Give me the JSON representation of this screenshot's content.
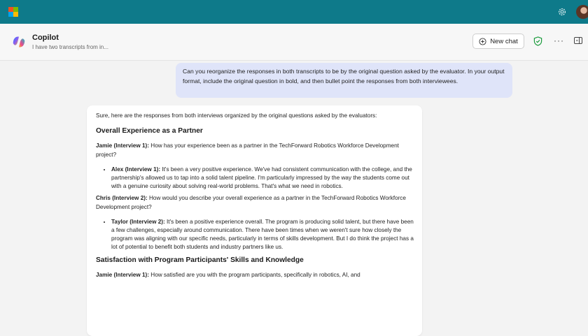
{
  "app": {
    "name": "Copilot",
    "subtitle": "I have two transcripts from in...",
    "topbar_color": "#0e7a8a"
  },
  "header": {
    "new_chat_label": "New chat",
    "more_label": "···"
  },
  "user_message": "Can you reorganize the responses in both transcripts to be by the original question asked by the evaluator. In your output format, include the original question in bold, and then bullet point the responses from both interviewees.",
  "response": {
    "intro": "Sure, here are the responses from both interviews organized by the original questions asked by the evaluators:",
    "sections": [
      {
        "heading": "Overall Experience as a Partner",
        "items": [
          {
            "q_speaker": "Jamie (Interview 1):",
            "q_text": " How has your experience been as a partner in the TechForward Robotics Workforce Development project?",
            "a_speaker": "Alex (Interview 1):",
            "a_text": " It's been a very positive experience. We've had consistent communication with the college, and the partnership's allowed us to tap into a solid talent pipeline. I'm particularly impressed by the way the students come out with a genuine curiosity about solving real-world problems. That's what we need in robotics."
          },
          {
            "q_speaker": "Chris (Interview 2):",
            "q_text": " How would you describe your overall experience as a partner in the TechForward Robotics Workforce Development project?",
            "a_speaker": "Taylor (Interview 2):",
            "a_text": " It's been a positive experience overall. The program is producing solid talent, but there have been a few challenges, especially around communication. There have been times when we weren't sure how closely the program was aligning with our specific needs, particularly in terms of skills development. But I do think the project has a lot of potential to benefit both students and industry partners like us."
          }
        ]
      },
      {
        "heading": "Satisfaction with Program Participants' Skills and Knowledge",
        "items": [
          {
            "q_speaker": "Jamie (Interview 1):",
            "q_text": " How satisfied are you with the program participants, specifically in robotics, AI, and"
          }
        ]
      }
    ]
  },
  "colors": {
    "user_bubble": "#dfe4f9",
    "shield_green": "#1a9b3c"
  }
}
